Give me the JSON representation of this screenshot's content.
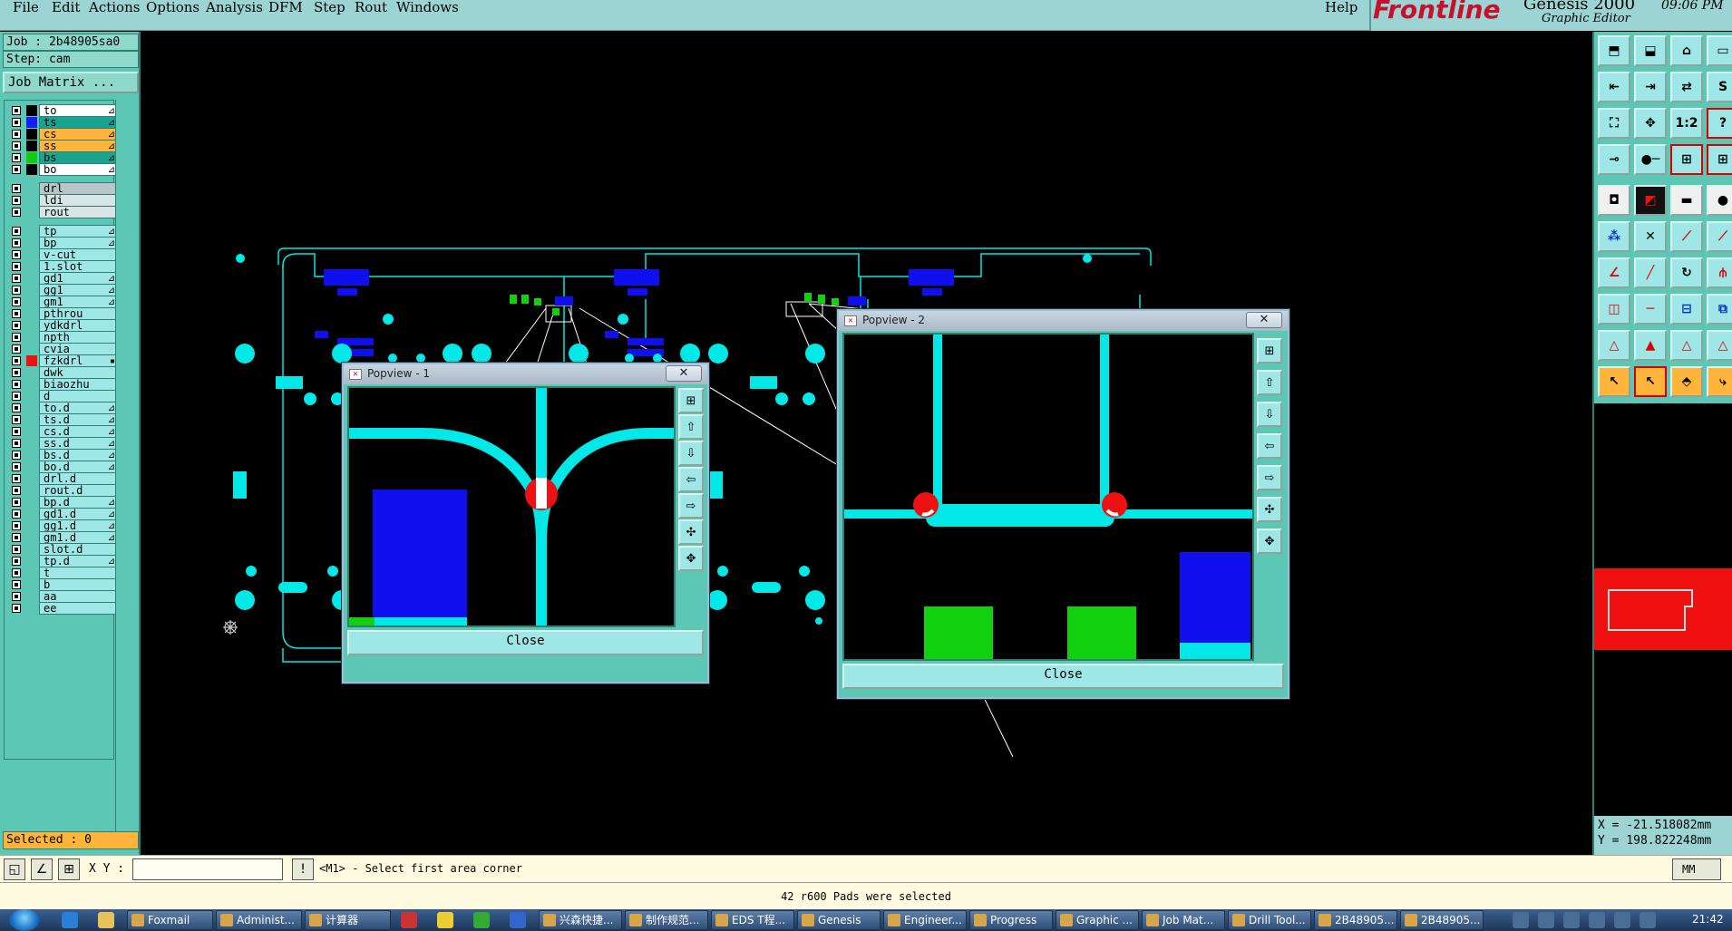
{
  "menu": {
    "items": [
      "File",
      "Edit",
      "Actions",
      "Options",
      "Analysis",
      "DFM",
      "Step",
      "Rout",
      "Windows"
    ],
    "help": "Help"
  },
  "brand": {
    "logo": "Frontline",
    "product": "Genesis 2000",
    "subtitle": "Graphic Editor",
    "time": "09:06 PM"
  },
  "job": {
    "job_line": "Job : 2b48905sa0",
    "step_line": "Step: cam",
    "matrix_button": "Job Matrix ..."
  },
  "layers": [
    {
      "name": "to",
      "color": "#000000",
      "fill": "white",
      "mark": "⊿"
    },
    {
      "name": "ts",
      "color": "#1a1aff",
      "fill": "teal",
      "mark": "⊿"
    },
    {
      "name": "cs",
      "color": "#000000",
      "fill": "orange",
      "mark": "⊿"
    },
    {
      "name": "ss",
      "color": "#000000",
      "fill": "orange",
      "mark": "⊿"
    },
    {
      "name": "bs",
      "color": "#10cc10",
      "fill": "teal",
      "mark": "⊿"
    },
    {
      "name": "bo",
      "color": "#000000",
      "fill": "white",
      "mark": "⊿"
    },
    {
      "name": "drl",
      "color": "",
      "fill": "grey",
      "mark": ""
    },
    {
      "name": "ldi",
      "color": "",
      "fill": "light",
      "mark": ""
    },
    {
      "name": "rout",
      "color": "",
      "fill": "light",
      "mark": ""
    },
    {
      "name": "tp",
      "color": "",
      "fill": "",
      "mark": "⊿"
    },
    {
      "name": "bp",
      "color": "",
      "fill": "",
      "mark": "⊿"
    },
    {
      "name": "v-cut",
      "color": "",
      "fill": "",
      "mark": ""
    },
    {
      "name": "1.slot",
      "color": "",
      "fill": "",
      "mark": ""
    },
    {
      "name": "gd1",
      "color": "",
      "fill": "",
      "mark": "⊿"
    },
    {
      "name": "gg1",
      "color": "",
      "fill": "",
      "mark": "⊿"
    },
    {
      "name": "gm1",
      "color": "",
      "fill": "",
      "mark": "⊿"
    },
    {
      "name": "pthrou",
      "color": "",
      "fill": "",
      "mark": ""
    },
    {
      "name": "ydkdrl",
      "color": "",
      "fill": "",
      "mark": ""
    },
    {
      "name": "npth",
      "color": "",
      "fill": "",
      "mark": ""
    },
    {
      "name": "cvia",
      "color": "",
      "fill": "",
      "mark": ""
    },
    {
      "name": "fzkdrl",
      "color": "#ee1111",
      "fill": "",
      "mark": "▪"
    },
    {
      "name": "dwk",
      "color": "",
      "fill": "",
      "mark": ""
    },
    {
      "name": "biaozhu",
      "color": "",
      "fill": "",
      "mark": ""
    },
    {
      "name": "d",
      "color": "",
      "fill": "",
      "mark": ""
    },
    {
      "name": "to.d",
      "color": "",
      "fill": "",
      "mark": "⊿"
    },
    {
      "name": "ts.d",
      "color": "",
      "fill": "",
      "mark": "⊿"
    },
    {
      "name": "cs.d",
      "color": "",
      "fill": "",
      "mark": "⊿"
    },
    {
      "name": "ss.d",
      "color": "",
      "fill": "",
      "mark": "⊿"
    },
    {
      "name": "bs.d",
      "color": "",
      "fill": "",
      "mark": "⊿"
    },
    {
      "name": "bo.d",
      "color": "",
      "fill": "",
      "mark": "⊿"
    },
    {
      "name": "drl.d",
      "color": "",
      "fill": "",
      "mark": ""
    },
    {
      "name": "rout.d",
      "color": "",
      "fill": "",
      "mark": ""
    },
    {
      "name": "bp.d",
      "color": "",
      "fill": "",
      "mark": "⊿"
    },
    {
      "name": "gd1.d",
      "color": "",
      "fill": "",
      "mark": "⊿"
    },
    {
      "name": "gg1.d",
      "color": "",
      "fill": "",
      "mark": "⊿"
    },
    {
      "name": "gm1.d",
      "color": "",
      "fill": "",
      "mark": "⊿"
    },
    {
      "name": "slot.d",
      "color": "",
      "fill": "",
      "mark": ""
    },
    {
      "name": "tp.d",
      "color": "",
      "fill": "",
      "mark": "⊿"
    },
    {
      "name": "t",
      "color": "",
      "fill": "",
      "mark": ""
    },
    {
      "name": "b",
      "color": "",
      "fill": "",
      "mark": ""
    },
    {
      "name": "aa",
      "color": "",
      "fill": "",
      "mark": ""
    },
    {
      "name": "ee",
      "color": "",
      "fill": "",
      "mark": ""
    }
  ],
  "selected": "Selected : 0",
  "popview1": {
    "title": "Popview - 1",
    "close_label": "Close"
  },
  "popview2": {
    "title": "Popview - 2",
    "close_label": "Close"
  },
  "coords": {
    "x": "X = -21.518082mm",
    "y": "Y = 198.822248mm"
  },
  "command": {
    "xy_label": "X Y :",
    "xy_value": "",
    "prompt": "<M1> - Select first area corner",
    "units": "MM"
  },
  "status": "42 r600 Pads were selected",
  "taskbar": {
    "buttons": [
      "Foxmail",
      "Administ...",
      "计算器",
      "兴森快捷...",
      "制作规范...",
      "EDS T程...",
      "Genesis",
      "Engineer...",
      "Progress",
      "Graphic ...",
      "Job Mat...",
      "Drill Tool...",
      "2B48905...",
      "2B48905..."
    ],
    "clock": "21:42"
  },
  "colors": {
    "cyan": "#00e8e8",
    "blue": "#1010ee",
    "green": "#10d010",
    "red": "#ee1111",
    "panel": "#5cc7b5"
  }
}
